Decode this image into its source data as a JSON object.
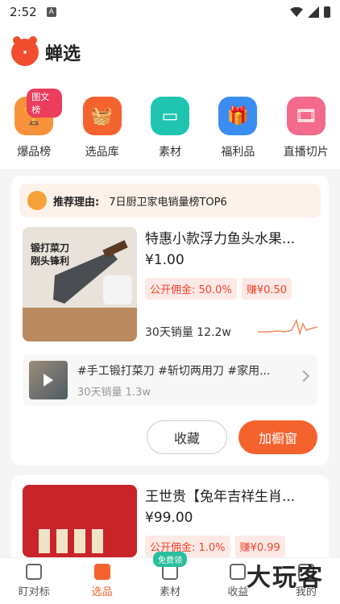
{
  "status": {
    "time": "2:52",
    "sim": "A"
  },
  "app": {
    "name": "蝉选"
  },
  "categories": [
    {
      "label": "爆品榜",
      "badge": "图文榜",
      "color": "#f7923b",
      "icon": "trophy-icon"
    },
    {
      "label": "选品库",
      "color": "#f4622e",
      "icon": "basket-icon"
    },
    {
      "label": "素材",
      "color": "#20c5b1",
      "icon": "card-icon"
    },
    {
      "label": "福利品",
      "color": "#3b8df4",
      "icon": "gift-icon"
    },
    {
      "label": "直播切片",
      "color": "#f46a8c",
      "icon": "film-icon"
    }
  ],
  "card1": {
    "reason_key": "推荐理由:",
    "reason_text": "7日厨卫家电销量榜TOP6",
    "title": "特惠小款浮力鱼头水果...",
    "price": "¥1.00",
    "commission": "公开佣金: 50.0%",
    "earn": "赚¥0.50",
    "sales": "30天销量 12.2w",
    "img_text": "锻打菜刀 刚头锋利",
    "video_title": "#手工锻打菜刀 #斩切两用刀 #家用...",
    "video_sales": "30天销量 1.3w",
    "fav_label": "收藏",
    "add_label": "加橱窗"
  },
  "card2": {
    "title": "王世贵【兔年吉祥生肖...",
    "price": "¥99.00",
    "commission": "公开佣金: 1.0%",
    "earn": "赚¥0.99"
  },
  "nav": [
    {
      "label": "盯对标",
      "icon": "target-icon"
    },
    {
      "label": "选品",
      "icon": "select-icon",
      "active": true
    },
    {
      "label": "素材",
      "icon": "video-icon",
      "badge": "免费领"
    },
    {
      "label": "收益",
      "icon": "income-icon"
    },
    {
      "label": "我的",
      "icon": "user-icon"
    }
  ],
  "watermark": "大玩客"
}
